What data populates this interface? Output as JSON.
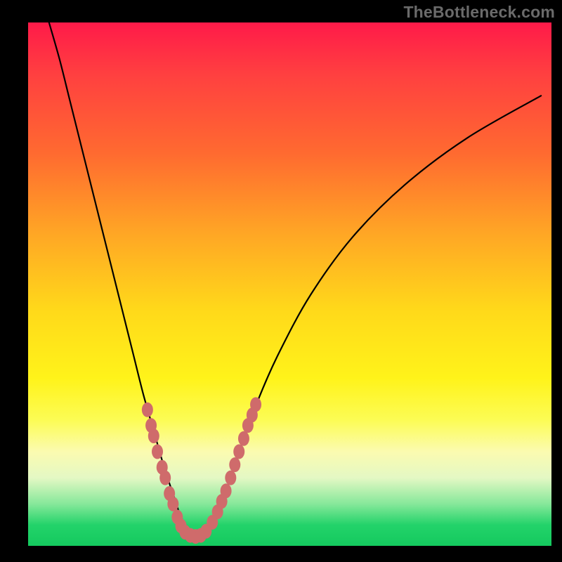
{
  "watermark": "TheBottleneck.com",
  "colors": {
    "curve": "#000000",
    "marker": "#cf6b6b",
    "gradient_top": "#ff1a49",
    "gradient_bottom": "#14c95e",
    "page_bg": "#000000"
  },
  "chart_data": {
    "type": "line",
    "title": "",
    "xlabel": "",
    "ylabel": "",
    "xlim": [
      0,
      100
    ],
    "ylim": [
      0,
      100
    ],
    "curve": {
      "name": "bottleneck-curve",
      "x": [
        4,
        6,
        8,
        10,
        12,
        14,
        16,
        18,
        20,
        22,
        24,
        26,
        28,
        29,
        30,
        31,
        32,
        33,
        34,
        36,
        38,
        40,
        44,
        48,
        54,
        62,
        72,
        84,
        98
      ],
      "y": [
        100,
        93,
        85,
        77,
        69,
        61,
        53,
        45,
        37,
        29,
        22,
        15,
        9,
        6,
        4,
        3,
        2,
        2,
        3,
        6,
        11,
        17,
        28,
        37,
        48,
        59,
        69,
        78,
        86
      ]
    },
    "markers": {
      "name": "highlight-points",
      "color": "#cf6b6b",
      "points": [
        {
          "x": 22.8,
          "y": 26
        },
        {
          "x": 23.5,
          "y": 23
        },
        {
          "x": 24.0,
          "y": 21
        },
        {
          "x": 24.7,
          "y": 18
        },
        {
          "x": 25.6,
          "y": 15
        },
        {
          "x": 26.2,
          "y": 13
        },
        {
          "x": 27.0,
          "y": 10
        },
        {
          "x": 27.7,
          "y": 8
        },
        {
          "x": 28.5,
          "y": 5.5
        },
        {
          "x": 29.2,
          "y": 3.8
        },
        {
          "x": 30.0,
          "y": 2.6
        },
        {
          "x": 31.0,
          "y": 2.0
        },
        {
          "x": 32.0,
          "y": 1.8
        },
        {
          "x": 33.0,
          "y": 2.0
        },
        {
          "x": 34.0,
          "y": 2.8
        },
        {
          "x": 35.2,
          "y": 4.5
        },
        {
          "x": 36.2,
          "y": 6.5
        },
        {
          "x": 37.0,
          "y": 8.5
        },
        {
          "x": 37.8,
          "y": 10.5
        },
        {
          "x": 38.7,
          "y": 13
        },
        {
          "x": 39.5,
          "y": 15.5
        },
        {
          "x": 40.3,
          "y": 18
        },
        {
          "x": 41.2,
          "y": 20.5
        },
        {
          "x": 42.0,
          "y": 23
        },
        {
          "x": 42.8,
          "y": 25
        },
        {
          "x": 43.5,
          "y": 27
        }
      ]
    }
  }
}
